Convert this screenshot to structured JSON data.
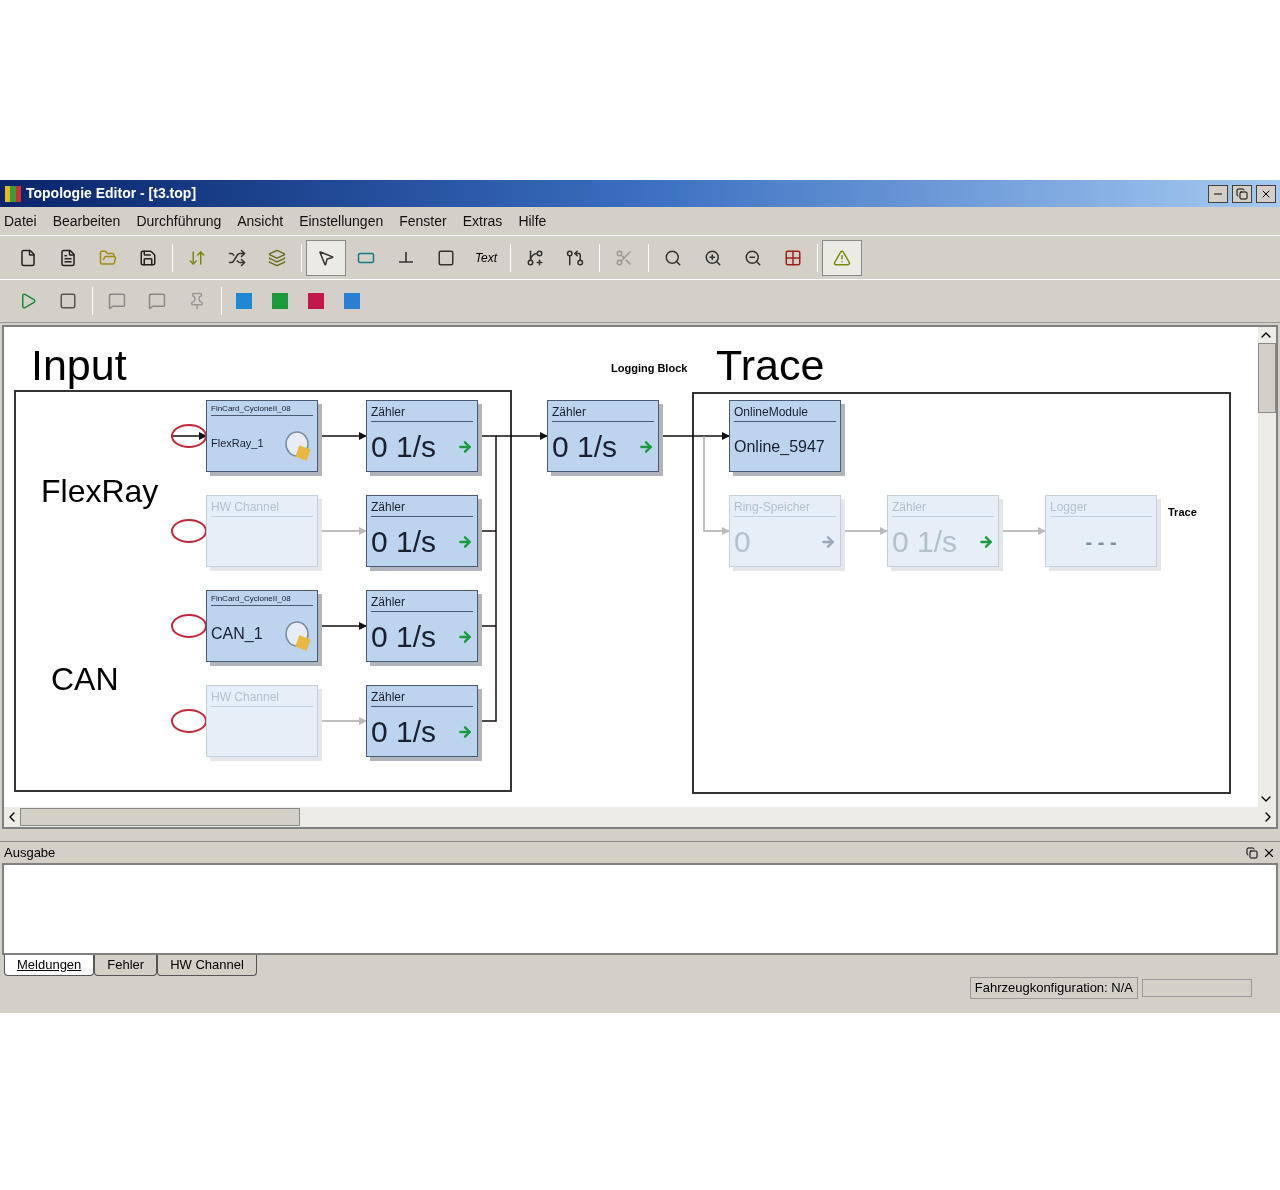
{
  "window": {
    "title": "Topologie Editor - [t3.top]"
  },
  "menu": [
    "Datei",
    "Bearbeiten",
    "Durchführung",
    "Ansicht",
    "Einstellungen",
    "Fenster",
    "Extras",
    "Hilfe"
  ],
  "toolbar_1": [
    {
      "kind": "new",
      "selected": false
    },
    {
      "kind": "page",
      "selected": false
    },
    {
      "kind": "open",
      "selected": false
    },
    {
      "kind": "save",
      "selected": false
    },
    {
      "kind": "sep"
    },
    {
      "kind": "import",
      "selected": false
    },
    {
      "kind": "distribute",
      "selected": false
    },
    {
      "kind": "build",
      "selected": false
    },
    {
      "kind": "sep"
    },
    {
      "kind": "pointer",
      "selected": true
    },
    {
      "kind": "block",
      "selected": false
    },
    {
      "kind": "connector",
      "selected": false
    },
    {
      "kind": "frame",
      "selected": false
    },
    {
      "kind": "text",
      "label": "Text",
      "selected": false
    },
    {
      "kind": "sep"
    },
    {
      "kind": "insert",
      "selected": false
    },
    {
      "kind": "remove",
      "selected": false
    },
    {
      "kind": "sep"
    },
    {
      "kind": "cut",
      "selected": false
    },
    {
      "kind": "sep"
    },
    {
      "kind": "search",
      "selected": false
    },
    {
      "kind": "zoom_in",
      "selected": false
    },
    {
      "kind": "zoom_out",
      "selected": false
    },
    {
      "kind": "grid",
      "selected": false
    },
    {
      "kind": "sep"
    },
    {
      "kind": "warning",
      "selected": true
    }
  ],
  "toolbar_2": [
    {
      "kind": "run"
    },
    {
      "kind": "stop"
    },
    {
      "kind": "sep"
    },
    {
      "kind": "comment"
    },
    {
      "kind": "comment"
    },
    {
      "kind": "pin"
    },
    {
      "kind": "sep"
    },
    {
      "kind": "module",
      "color": "#1e88d0"
    },
    {
      "kind": "module",
      "color": "#1a9a3a"
    },
    {
      "kind": "module",
      "color": "#c0184a"
    },
    {
      "kind": "module",
      "color": "#2a7fd4"
    }
  ],
  "diagram": {
    "labels": [
      {
        "kind": "heading",
        "text": "Input"
      },
      {
        "kind": "group",
        "text": "FlexRay"
      },
      {
        "kind": "group",
        "text": "CAN"
      },
      {
        "kind": "caption",
        "text": "Logging Block"
      },
      {
        "kind": "heading",
        "text": "Trace"
      },
      {
        "kind": "caption",
        "text": "Trace"
      }
    ],
    "blocks": [
      {
        "kind": "card",
        "title": "FlnCard_CycloneII_08",
        "value": "FlexRay_1",
        "enabled": true
      },
      {
        "kind": "counter",
        "title": "Zähler",
        "value": "0 1/s",
        "enabled": true
      },
      {
        "kind": "channel",
        "title": "HW Channel",
        "enabled": false
      },
      {
        "kind": "counter",
        "title": "Zähler",
        "value": "0 1/s",
        "enabled": true
      },
      {
        "kind": "card",
        "title": "FlnCard_CycloneII_08",
        "value": "CAN_1",
        "enabled": true
      },
      {
        "kind": "counter",
        "title": "Zähler",
        "value": "0 1/s",
        "enabled": true
      },
      {
        "kind": "channel",
        "title": "HW Channel",
        "enabled": false
      },
      {
        "kind": "counter",
        "title": "Zähler",
        "value": "0 1/s",
        "enabled": true
      },
      {
        "kind": "counter",
        "title": "Zähler",
        "value": "0 1/s",
        "enabled": true
      },
      {
        "kind": "online",
        "title": "OnlineModule",
        "value": "Online_5947",
        "enabled": true
      },
      {
        "kind": "ring",
        "title": "Ring-Speicher",
        "value": "0",
        "enabled": false
      },
      {
        "kind": "counter",
        "title": "Zähler",
        "value": "0 1/s",
        "enabled": false
      },
      {
        "kind": "logger",
        "title": "Logger",
        "value": "- - -",
        "enabled": false
      }
    ]
  },
  "output": {
    "title": "Ausgabe",
    "tabs": [
      {
        "label": "Meldungen",
        "selected": true
      },
      {
        "label": "Fehler",
        "selected": false
      },
      {
        "label": "HW Channel",
        "selected": false
      }
    ]
  },
  "status_bar": {
    "text": "Fahrzeugkonfiguration: N/A"
  }
}
